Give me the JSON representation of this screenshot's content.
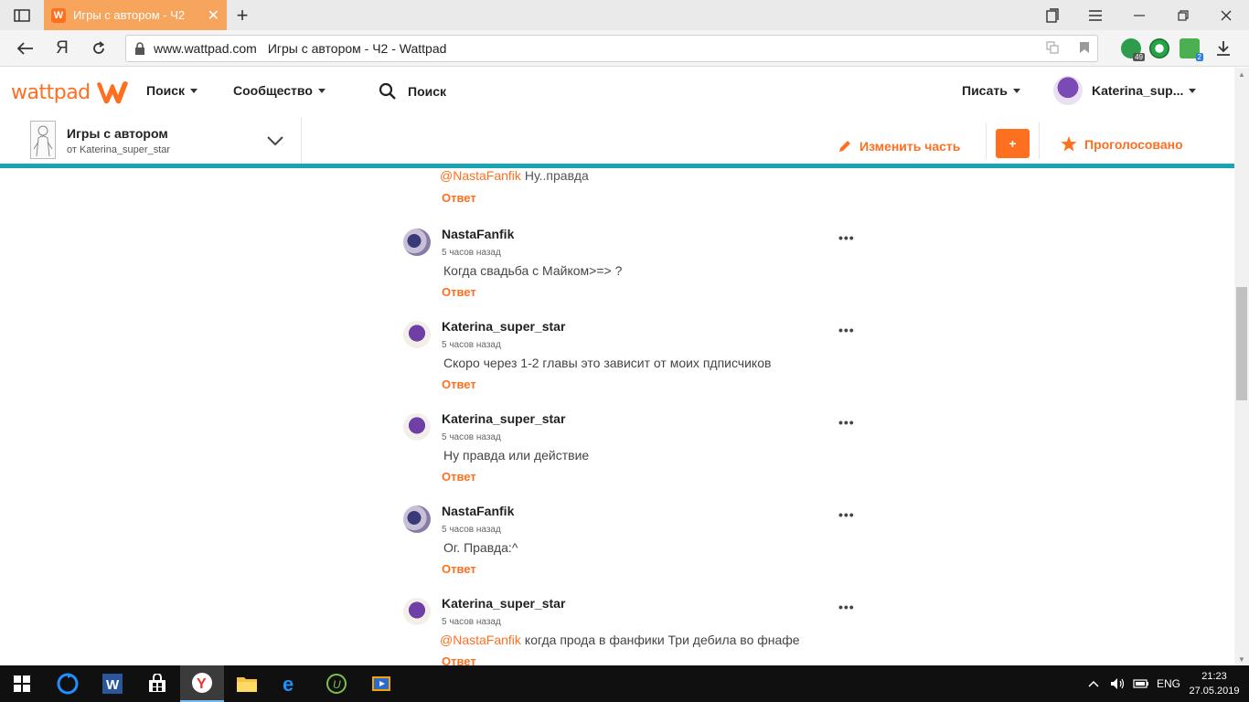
{
  "browser": {
    "tab_title": "Игры с автором - Ч2",
    "address_domain": "www.wattpad.com",
    "address_title": "Игры с автором - Ч2 - Wattpad",
    "yandex_label": "Я",
    "ext_badge_1": "49",
    "ext_badge_2": "2"
  },
  "header": {
    "logo_text": "wattpad",
    "nav_search": "Поиск",
    "nav_community": "Сообщество",
    "search_label": "Поиск",
    "write_label": "Писать",
    "username": "Katerina_sup..."
  },
  "story": {
    "title": "Игры с автором",
    "author": "от Katerina_super_star",
    "edit_label": "Изменить часть",
    "plus_label": "+",
    "voted_label": "Проголосовано"
  },
  "comments": {
    "top_fragment": {
      "mention": "@NastaFanfik",
      "text": "Ну..правда",
      "reply_label": "Ответ"
    },
    "items": [
      {
        "author": "NastaFanfik",
        "time": "5 часов назад",
        "mention": "",
        "text": "Когда свадьба с Майком>=> ?",
        "reply_label": "Ответ",
        "more": "•••"
      },
      {
        "author": "Katerina_super_star",
        "time": "5 часов назад",
        "mention": "",
        "text": "Скоро через 1-2 главы это зависит от моих пдписчиков",
        "reply_label": "Ответ",
        "more": "•••"
      },
      {
        "author": "Katerina_super_star",
        "time": "5 часов назад",
        "mention": "",
        "text": "Ну правда или действие",
        "reply_label": "Ответ",
        "more": "•••"
      },
      {
        "author": "NastaFanfik",
        "time": "5 часов назад",
        "mention": "",
        "text": "Ог. Правда:^",
        "reply_label": "Ответ",
        "more": "•••"
      },
      {
        "author": "Katerina_super_star",
        "time": "5 часов назад",
        "mention": "@NastaFanfik",
        "text": "когда прода в фанфики Три дебила во фнафе",
        "reply_label": "Ответ",
        "more": "•••"
      }
    ]
  },
  "taskbar": {
    "lang": "ENG",
    "time": "21:23",
    "date": "27.05.2019"
  },
  "colors": {
    "accent": "#ff6f20",
    "teal": "#19a4b4",
    "tab": "#f7a45d",
    "taskbar": "#101010"
  }
}
